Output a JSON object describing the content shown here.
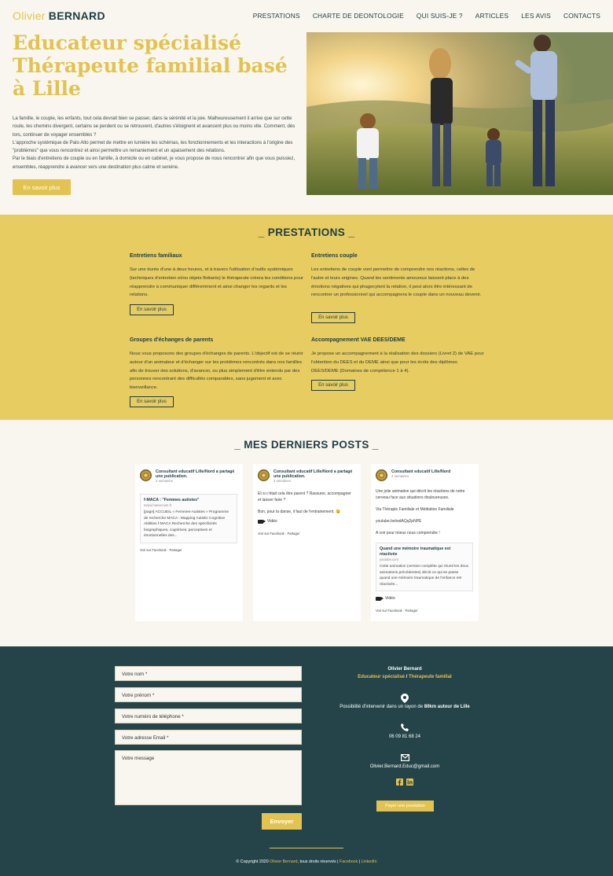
{
  "header": {
    "logo_first": "Olivier",
    "logo_last": "BERNARD",
    "nav": [
      "PRESTATIONS",
      "CHARTE DE DEONTOLOGIE",
      "QUI SUIS-JE ?",
      "ARTICLES",
      "LES AVIS",
      "CONTACTS"
    ]
  },
  "hero": {
    "title": "Educateur spécialisé Thérapeute familial basé à Lille",
    "paragraphs": [
      "La famille, le couple, les enfants, tout cela devrait bien se passer, dans la sérénité et la joie. Malheureusement il arrive que sur cette route, les chemins divergent, certains se perdent ou se retrouvent, d'autres s'éloignent et avancent plus ou moins vite. Comment, dès lors, continuer de voyager ensembles ?",
      "L'approche systémique de Palo Alto permet de mettre en lumière les schémas, les fonctionnements et les interactions à l'origine des \"problèmes\" que vous rencontrez et ainsi permettre un remaniement et un apaisement des relations.",
      "Par le biais d'entretiens de couple ou en famille, à domicile ou en cabinet, je vous propose de nous rencontrer afin que vous puissiez, ensembles, réapprendre à avancer vers une destination plus calme et sereine."
    ],
    "button": "En savoir plus"
  },
  "prestations": {
    "title": "_ PRESTATIONS _",
    "items": [
      {
        "title": "Entretiens familiaux",
        "text": "Sur une durée d'une à deux heures, et à travers l'utilisation d'outils systémiques (techniques d'entretien et/ou objets flottants) le thérapeute créera les conditions pour réapprendre à communiquer différemment et ainsi changer les regards et les relations.",
        "button": "En savoir plus"
      },
      {
        "title": "Entretiens couple",
        "text": "Les entretiens de couple vont permettre de comprendre nos réactions, celles de l'autre et leurs origines. Quand les sentiments amoureux laissent place à des émotions négatives qui phagocytent la relation, il peut alors être intéressant de rencontrer un professionnel qui accompagnera le couple dans un nouveau devenir.",
        "button": "En savoir plus"
      },
      {
        "title": "Groupes d'échanges de parents",
        "text": "Nous vous proposons des groupes d'échanges de parents. L'objectif est de se réunir autour d'un animateur et d'échanger sur les problèmes rencontrés dans nos familles afin de trouver des solutions, d'avancer, ou plus simplement d'être entendu par des personnes rencontrant des difficultés comparables, sans jugement et avec bienveillance.",
        "button": "En savoir plus"
      },
      {
        "title": "Accompagnement VAE DEES/DEME",
        "text": "Je propose un accompagnement à la réalisation des dossiers (Livret 2) de VAE pour l'obtention du DEES et du DEME ainsi que pour les écrits des diplômes DEES/DEME (Domaines de compétence 1 à 4).",
        "button": "En savoir plus"
      }
    ]
  },
  "posts": {
    "title": "_ MES DERNIERS POSTS _",
    "items": [
      {
        "author": "Consultant educatif Lille/Nord a partagé une publication.",
        "time": "2 semaines",
        "card_title": "f-MACA : \"Femmes autistes\"",
        "card_domain": "maca.huma-num.fr",
        "card_text": "[page] ACCUEIL « Femmes-Autistes » Programme de recherche MACA : Mapping Autistic Cognitive Abilities f-MACA Recherche des spécificités biographiques, cognitives, perceptives et émotionnelles des...",
        "footer": "Voir sur Facebook · Partager"
      },
      {
        "author": "Consultant educatif Lille/Nord a partagé une publication.",
        "time": "3 semaines",
        "body1": "Et si c'était cela être parent ? Rassurer, accompagner et laisser faire ?",
        "body2": "Bon, pour la danse, il faut de l'entrainement. 😉",
        "video": "Vidéo",
        "footer": "Voir sur Facebook · Partager"
      },
      {
        "author": "Consultant educatif Lille/Nord",
        "time": "4 semaines",
        "body1": "Une jolie animation qui décrit les réactions de notre cerveau face aux situations douloureuses.",
        "body2": "Via Thérapie Familiale et Médiation Familiale",
        "body3": "youtube.be/wdAQq2pNPE",
        "body4": "A voir pour mieux nous comprendre !",
        "card_title": "Quand une mémoire traumatique est réactivée",
        "card_domain": "youtube.com",
        "card_text": "Cette animation (version complète qui réunit les deux animations précédentes) décrit ce qui se passe quand une mémoire traumatique de l'enfance est réactivée...",
        "video": "Vidéo",
        "footer": "Voir sur Facebook · Partager"
      }
    ]
  },
  "form": {
    "name": "Votre nom *",
    "firstname": "Votre prénom *",
    "phone": "Votre numéro de téléphone *",
    "email": "Votre adresse Email *",
    "message": "Votre message",
    "submit": "Envoyer"
  },
  "contact": {
    "name": "Olivier Bernard",
    "role_a": "Educateur spécialisé",
    "sep": " / ",
    "role_b": "Thérapeute familial",
    "location_pre": "Possibilité d'intervenir dans un rayon de ",
    "location_bold": "80km autour de Lille",
    "phone": "06 09 81 68 24",
    "email": "Olivier.Bernard.Educ@gmail.com",
    "pay_button": "Payer une prestation"
  },
  "copyright": {
    "pre": "© Copyright 2020 ",
    "name": "Olivier Bernard",
    "mid": ", tous droits réservés | ",
    "facebook": "Facebook",
    "sep": " | ",
    "linkedin": "LinkedIn"
  },
  "colors": {
    "gold": "#e3c34f",
    "dark_teal": "#244449",
    "cream": "#f8f6ee",
    "mustard_band": "#e6cc61"
  }
}
